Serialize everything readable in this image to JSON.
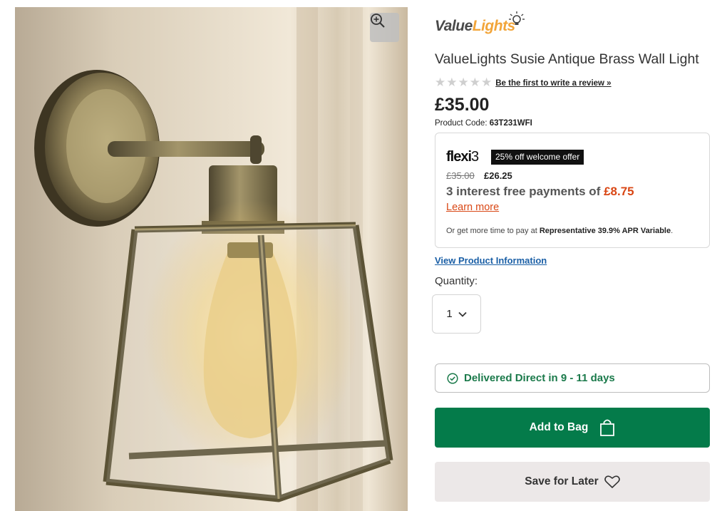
{
  "brand": {
    "part1": "Value",
    "part2": "Lights"
  },
  "product": {
    "title": "ValueLights Susie Antique Brass Wall Light",
    "rating_stars": 5,
    "review_link": "Be the first to write a review »",
    "price": "£35.00",
    "code_label": "Product Code:",
    "code_value": "63T231WFI"
  },
  "flexi": {
    "logo_word": "flexi",
    "logo_num": "3",
    "offer_badge": "25% off welcome offer",
    "old_price": "£35.00",
    "new_price": "£26.25",
    "instalment_text": "3 interest free payments of ",
    "instalment_amount": "£8.75",
    "learn_more": "Learn more",
    "apr_text": "Or get more time to pay at ",
    "apr_bold": "Representative 39.9% APR Variable",
    "apr_end": "."
  },
  "view_info_link": "View Product Information",
  "quantity": {
    "label": "Quantity:",
    "value": "1"
  },
  "delivery": {
    "text": "Delivered Direct in 9 - 11 days"
  },
  "buttons": {
    "add_to_bag": "Add to Bag",
    "save_for_later": "Save for Later"
  },
  "icons": {
    "zoom": "zoom-in-icon",
    "bulb": "lightbulb-logo-icon",
    "star": "star-icon",
    "chevron": "chevron-down-icon",
    "check": "check-circle-icon",
    "bag": "shopping-bag-icon",
    "heart": "heart-icon"
  },
  "colors": {
    "accent_green": "#047b4a",
    "delivery_green": "#1b7a4b",
    "flexi_orange": "#d94715",
    "link_blue": "#1a5fa6",
    "brand_orange": "#f2a53a"
  }
}
